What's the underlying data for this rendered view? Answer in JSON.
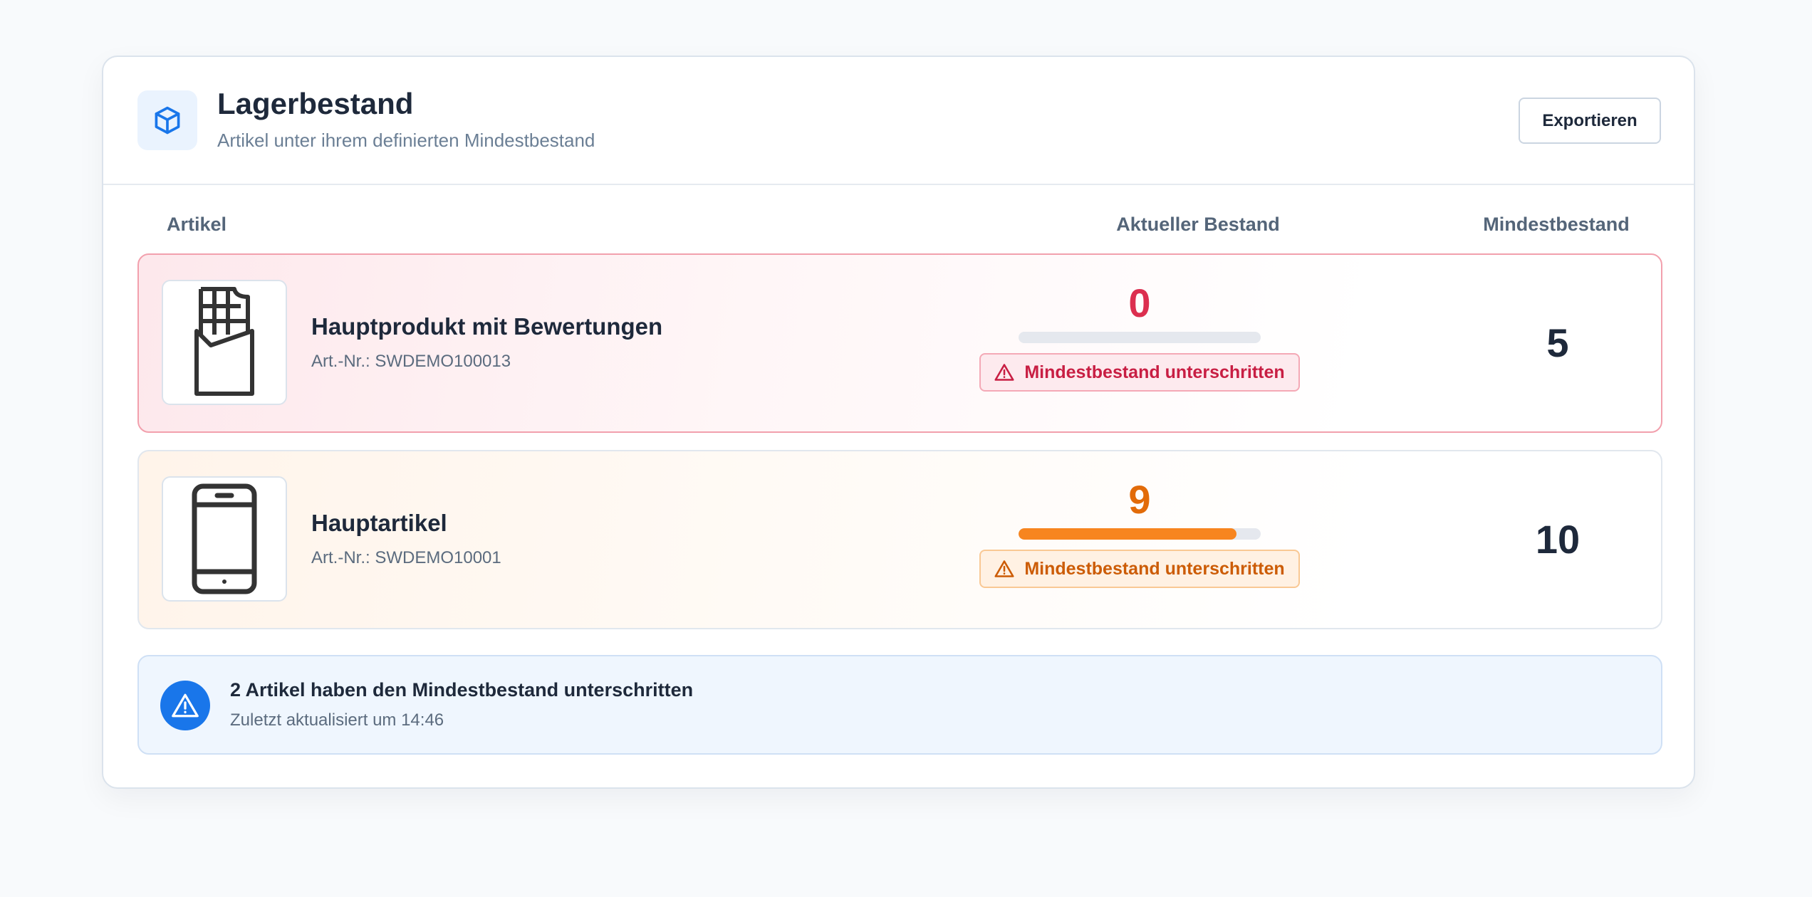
{
  "header": {
    "icon": "package-cube-icon",
    "title": "Lagerbestand",
    "subtitle": "Artikel unter ihrem definierten Mindestbestand",
    "export_label": "Exportieren"
  },
  "columns": {
    "article": "Artikel",
    "current_stock": "Aktueller Bestand",
    "min_stock": "Mindestbestand"
  },
  "items": [
    {
      "name": "Hauptprodukt mit Bewertungen",
      "sku": "Art.-Nr.: SWDEMO100013",
      "image_icon": "chocolate-bar-icon",
      "current_stock": 0,
      "min_stock": 5,
      "stock_fraction": 0.0,
      "warning": "Mindestbestand unterschritten",
      "status_color": "#dc2f4f"
    },
    {
      "name": "Hauptartikel",
      "sku": "Art.-Nr.: SWDEMO10001",
      "image_icon": "smartphone-icon",
      "current_stock": 9,
      "min_stock": 10,
      "stock_fraction": 0.9,
      "warning": "Mindestbestand unterschritten",
      "status_color": "#e26b09"
    }
  ],
  "summary": {
    "icon": "alert-triangle-icon",
    "title": "2 Artikel haben den Mindestbestand unterschritten",
    "updated": "Zuletzt aktualisiert um 14:46"
  },
  "colors": {
    "accent_blue": "#1976ea",
    "danger": "#dc2f4f",
    "warning": "#f7851f"
  }
}
